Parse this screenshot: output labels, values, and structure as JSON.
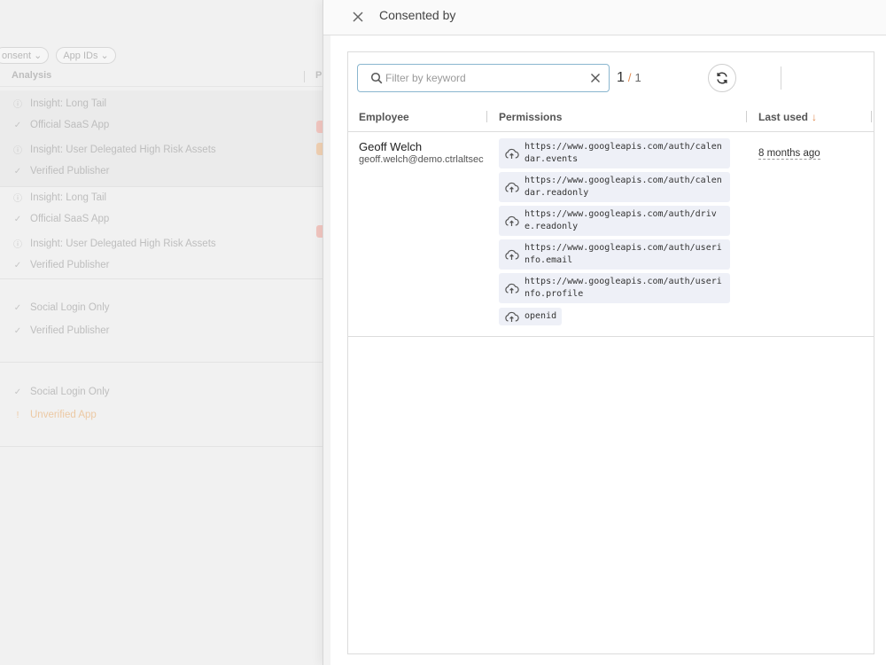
{
  "background": {
    "filters": [
      "onsent",
      "App IDs"
    ],
    "columns": [
      "Analysis",
      "P"
    ],
    "rows": [
      {
        "icon": "info",
        "text": "Insight: Long Tail"
      },
      {
        "icon": "check",
        "text": "Official SaaS App"
      },
      {
        "icon": "info",
        "text": "Insight: User Delegated High Risk Assets"
      },
      {
        "icon": "check",
        "text": "Verified Publisher"
      },
      {
        "icon": "info",
        "text": "Insight: Long Tail"
      },
      {
        "icon": "check",
        "text": "Official SaaS App"
      },
      {
        "icon": "info",
        "text": "Insight: User Delegated High Risk Assets"
      },
      {
        "icon": "check",
        "text": "Verified Publisher"
      },
      {
        "icon": "check",
        "text": "Social Login Only"
      },
      {
        "icon": "check",
        "text": "Verified Publisher"
      },
      {
        "icon": "check",
        "text": "Social Login Only"
      },
      {
        "icon": "warning",
        "text": "Unverified App"
      }
    ]
  },
  "panel": {
    "title": "Consented by",
    "search": {
      "placeholder": "Filter by keyword",
      "value": ""
    },
    "pager": {
      "current": "1",
      "total": "1"
    },
    "columns": {
      "employee": "Employee",
      "permissions": "Permissions",
      "last_used": "Last used"
    },
    "rows": [
      {
        "name": "Geoff Welch",
        "email": "geoff.welch@demo.ctrlaltsec",
        "permissions": [
          "https://www.googleapis.com/auth/calendar.events",
          "https://www.googleapis.com/auth/calendar.readonly",
          "https://www.googleapis.com/auth/drive.readonly",
          "https://www.googleapis.com/auth/userinfo.email",
          "https://www.googleapis.com/auth/userinfo.profile",
          "openid"
        ],
        "last_used": "8 months ago"
      }
    ]
  },
  "colors": {
    "accent": "#e0894f",
    "focus_border": "#8ab6cf",
    "chip_bg": "#eef0f7"
  },
  "icons": {
    "close": "close-icon",
    "search": "search-icon",
    "clear": "clear-icon",
    "refresh": "refresh-icon",
    "permission": "cloud-icon",
    "sort": "sort-down-arrow-icon"
  }
}
